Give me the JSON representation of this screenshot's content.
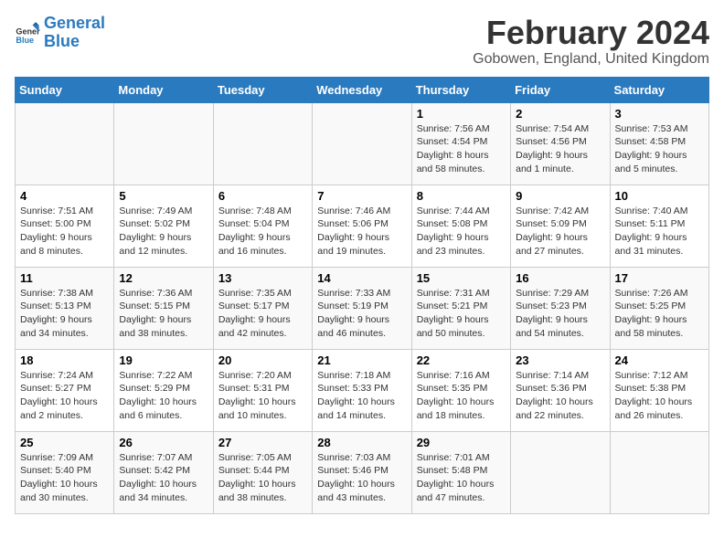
{
  "header": {
    "logo_line1": "General",
    "logo_line2": "Blue",
    "main_title": "February 2024",
    "subtitle": "Gobowen, England, United Kingdom"
  },
  "days_of_week": [
    "Sunday",
    "Monday",
    "Tuesday",
    "Wednesday",
    "Thursday",
    "Friday",
    "Saturday"
  ],
  "weeks": [
    [
      {
        "day": "",
        "info": ""
      },
      {
        "day": "",
        "info": ""
      },
      {
        "day": "",
        "info": ""
      },
      {
        "day": "",
        "info": ""
      },
      {
        "day": "1",
        "info": "Sunrise: 7:56 AM\nSunset: 4:54 PM\nDaylight: 8 hours\nand 58 minutes."
      },
      {
        "day": "2",
        "info": "Sunrise: 7:54 AM\nSunset: 4:56 PM\nDaylight: 9 hours\nand 1 minute."
      },
      {
        "day": "3",
        "info": "Sunrise: 7:53 AM\nSunset: 4:58 PM\nDaylight: 9 hours\nand 5 minutes."
      }
    ],
    [
      {
        "day": "4",
        "info": "Sunrise: 7:51 AM\nSunset: 5:00 PM\nDaylight: 9 hours\nand 8 minutes."
      },
      {
        "day": "5",
        "info": "Sunrise: 7:49 AM\nSunset: 5:02 PM\nDaylight: 9 hours\nand 12 minutes."
      },
      {
        "day": "6",
        "info": "Sunrise: 7:48 AM\nSunset: 5:04 PM\nDaylight: 9 hours\nand 16 minutes."
      },
      {
        "day": "7",
        "info": "Sunrise: 7:46 AM\nSunset: 5:06 PM\nDaylight: 9 hours\nand 19 minutes."
      },
      {
        "day": "8",
        "info": "Sunrise: 7:44 AM\nSunset: 5:08 PM\nDaylight: 9 hours\nand 23 minutes."
      },
      {
        "day": "9",
        "info": "Sunrise: 7:42 AM\nSunset: 5:09 PM\nDaylight: 9 hours\nand 27 minutes."
      },
      {
        "day": "10",
        "info": "Sunrise: 7:40 AM\nSunset: 5:11 PM\nDaylight: 9 hours\nand 31 minutes."
      }
    ],
    [
      {
        "day": "11",
        "info": "Sunrise: 7:38 AM\nSunset: 5:13 PM\nDaylight: 9 hours\nand 34 minutes."
      },
      {
        "day": "12",
        "info": "Sunrise: 7:36 AM\nSunset: 5:15 PM\nDaylight: 9 hours\nand 38 minutes."
      },
      {
        "day": "13",
        "info": "Sunrise: 7:35 AM\nSunset: 5:17 PM\nDaylight: 9 hours\nand 42 minutes."
      },
      {
        "day": "14",
        "info": "Sunrise: 7:33 AM\nSunset: 5:19 PM\nDaylight: 9 hours\nand 46 minutes."
      },
      {
        "day": "15",
        "info": "Sunrise: 7:31 AM\nSunset: 5:21 PM\nDaylight: 9 hours\nand 50 minutes."
      },
      {
        "day": "16",
        "info": "Sunrise: 7:29 AM\nSunset: 5:23 PM\nDaylight: 9 hours\nand 54 minutes."
      },
      {
        "day": "17",
        "info": "Sunrise: 7:26 AM\nSunset: 5:25 PM\nDaylight: 9 hours\nand 58 minutes."
      }
    ],
    [
      {
        "day": "18",
        "info": "Sunrise: 7:24 AM\nSunset: 5:27 PM\nDaylight: 10 hours\nand 2 minutes."
      },
      {
        "day": "19",
        "info": "Sunrise: 7:22 AM\nSunset: 5:29 PM\nDaylight: 10 hours\nand 6 minutes."
      },
      {
        "day": "20",
        "info": "Sunrise: 7:20 AM\nSunset: 5:31 PM\nDaylight: 10 hours\nand 10 minutes."
      },
      {
        "day": "21",
        "info": "Sunrise: 7:18 AM\nSunset: 5:33 PM\nDaylight: 10 hours\nand 14 minutes."
      },
      {
        "day": "22",
        "info": "Sunrise: 7:16 AM\nSunset: 5:35 PM\nDaylight: 10 hours\nand 18 minutes."
      },
      {
        "day": "23",
        "info": "Sunrise: 7:14 AM\nSunset: 5:36 PM\nDaylight: 10 hours\nand 22 minutes."
      },
      {
        "day": "24",
        "info": "Sunrise: 7:12 AM\nSunset: 5:38 PM\nDaylight: 10 hours\nand 26 minutes."
      }
    ],
    [
      {
        "day": "25",
        "info": "Sunrise: 7:09 AM\nSunset: 5:40 PM\nDaylight: 10 hours\nand 30 minutes."
      },
      {
        "day": "26",
        "info": "Sunrise: 7:07 AM\nSunset: 5:42 PM\nDaylight: 10 hours\nand 34 minutes."
      },
      {
        "day": "27",
        "info": "Sunrise: 7:05 AM\nSunset: 5:44 PM\nDaylight: 10 hours\nand 38 minutes."
      },
      {
        "day": "28",
        "info": "Sunrise: 7:03 AM\nSunset: 5:46 PM\nDaylight: 10 hours\nand 43 minutes."
      },
      {
        "day": "29",
        "info": "Sunrise: 7:01 AM\nSunset: 5:48 PM\nDaylight: 10 hours\nand 47 minutes."
      },
      {
        "day": "",
        "info": ""
      },
      {
        "day": "",
        "info": ""
      }
    ]
  ]
}
